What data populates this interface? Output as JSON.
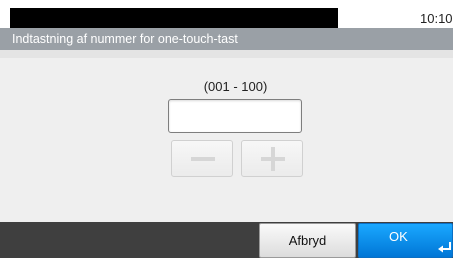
{
  "status": {
    "time": "10:10"
  },
  "title": "Indtastning af nummer for one-touch-tast",
  "entry": {
    "range_label": "(001 - 100)",
    "value": ""
  },
  "stepper": {
    "decrement_icon": "minus-icon",
    "increment_icon": "plus-icon",
    "enabled": false
  },
  "footer": {
    "cancel_label": "Afbryd",
    "ok_label": "OK",
    "ok_icon": "enter-return-icon"
  },
  "colors": {
    "ok_blue": "#0a8ff0",
    "title_bar": "#9aa0a6",
    "footer_bar": "#3f3f3f"
  }
}
